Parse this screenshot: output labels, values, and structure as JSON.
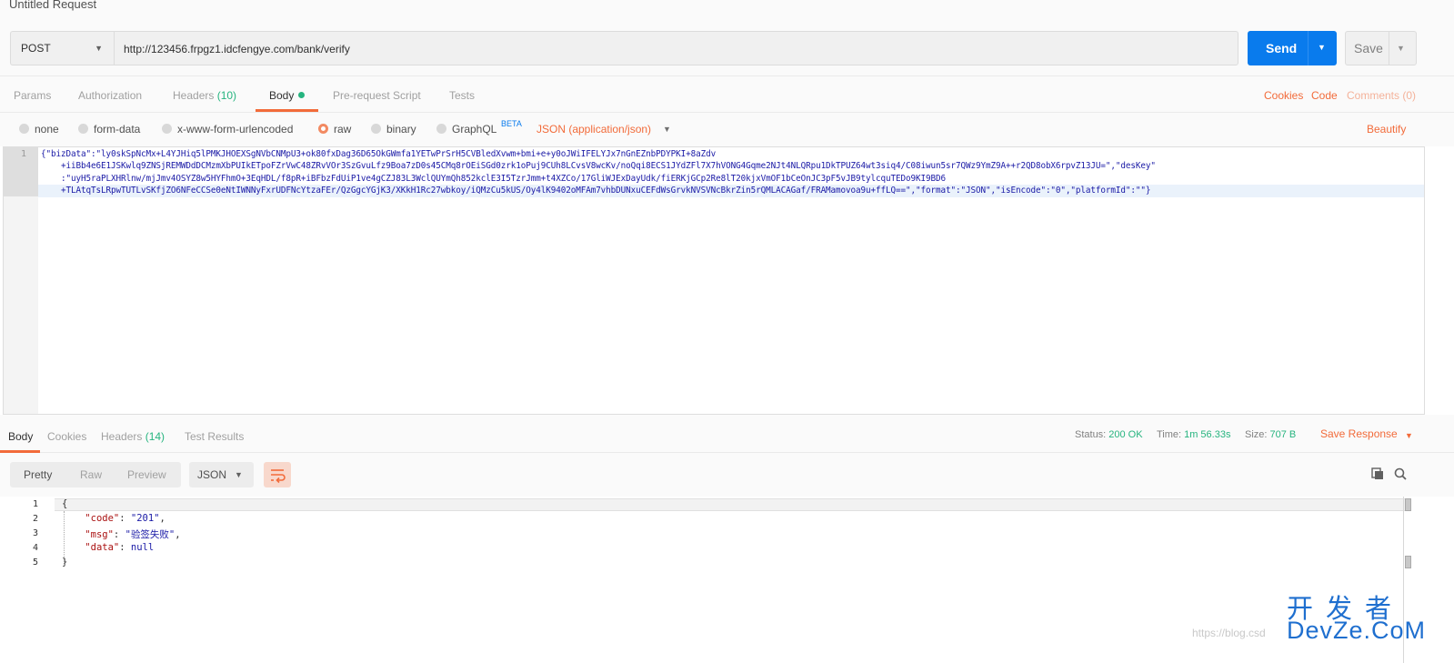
{
  "window": {
    "title": "Untitled Request"
  },
  "request": {
    "method": "POST",
    "url": "http://123456.frpgz1.idcfengye.com/bank/verify",
    "send_label": "Send",
    "save_label": "Save"
  },
  "request_tabs": {
    "params": "Params",
    "authorization": "Authorization",
    "headers": "Headers",
    "headers_count": "(10)",
    "body": "Body",
    "prerequest": "Pre-request Script",
    "tests": "Tests",
    "cookies": "Cookies",
    "code": "Code",
    "comments": "Comments (0)"
  },
  "body_types": {
    "none": "none",
    "form_data": "form-data",
    "urlencoded": "x-www-form-urlencoded",
    "raw": "raw",
    "binary": "binary",
    "graphql": "GraphQL",
    "beta": "BETA",
    "content_type": "JSON (application/json)",
    "beautify": "Beautify",
    "selected": "raw"
  },
  "request_body": {
    "line_number": "1",
    "lines": [
      "{\"bizData\":\"ly0skSpNcMx+L4YJHiq5lPMKJHOEXSgNVbCNMpU3+ok80fxDag36D65OkGWmfa1YETwPrSrH5CVBledXvwm+bmi+e+y0oJWiIFELYJx7nGnEZnbPDYPKI+8aZdv",
      "    +iiBb4e6E1JSKwlq9ZNSjREMWDdDCMzmXbPUIkETpoFZrVwC48ZRvVOr3SzGvuLfz9Boa7zD0s45CMq8rOEiSGd0zrk1oPuj9CUh8LCvsV8wcKv/noQqi8ECS1JYdZFl7X7hVONG4Gqme2NJt4NLQRpu1DkTPUZ64wt3siq4/C08iwun5sr7QWz9YmZ9A++r2QD8obX6rpvZ13JU=\",\"desKey\"",
      "    :\"uyH5raPLXHRlnw/mjJmv4OSYZ8w5HYFhmO+3EqHDL/f8pR+iBFbzFdUiP1ve4gCZJ83L3WclQUYmQh852kclE3I5TzrJmm+t4XZCo/17GliWJExDayUdk/fiERKjGCp2Re8lT20kjxVmOF1bCeOnJC3pF5vJB9tylcquTEDo9KI9BD6",
      "    +TLAtqTsLRpwTUTLvSKfjZO6NFeCCSe0eNtIWNNyFxrUDFNcYtzaFEr/QzGgcYGjK3/XKkH1Rc27wbkoy/iQMzCu5kUS/Oy4lK9402oMFAm7vhbDUNxuCEFdWsGrvkNVSVNcBkrZin5rQMLACAGaf/FRAMamovoa9u+ffLQ==\",\"format\":\"JSON\",\"isEncode\":\"0\",\"platformId\":\"\"}"
    ]
  },
  "response_tabs": {
    "body": "Body",
    "cookies": "Cookies",
    "headers": "Headers",
    "headers_count": "(14)",
    "test_results": "Test Results"
  },
  "response_status": {
    "status_label": "Status:",
    "status_value": "200 OK",
    "time_label": "Time:",
    "time_value": "1m 56.33s",
    "size_label": "Size:",
    "size_value": "707 B",
    "save_response": "Save Response"
  },
  "response_toolbar": {
    "pretty": "Pretty",
    "raw": "Raw",
    "preview": "Preview",
    "format": "JSON"
  },
  "response_body": {
    "line_numbers": [
      "1",
      "2",
      "3",
      "4",
      "5"
    ],
    "open_brace": "{",
    "close_brace": "}",
    "code_key": "\"code\"",
    "code_value": "\"201\"",
    "msg_key": "\"msg\"",
    "msg_value": "\"验签失败\"",
    "data_key": "\"data\"",
    "data_value": "null"
  },
  "watermark": {
    "url": "https://blog.csd",
    "logo_cn": "开发者",
    "logo_en": "DevZe.CoM"
  },
  "colors": {
    "accent": "#f26b3a",
    "send_blue": "#097bed",
    "success_green": "#26b47f"
  }
}
